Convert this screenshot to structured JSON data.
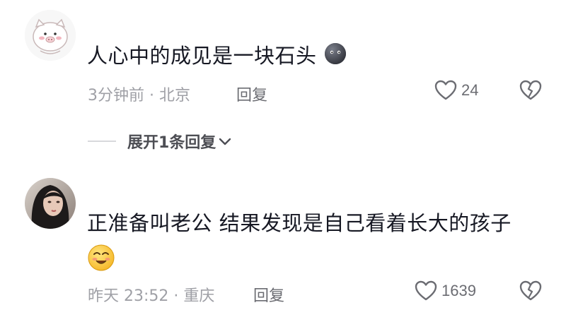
{
  "comments": [
    {
      "username": "",
      "text": "人心中的成见是一块石头",
      "emoji": "dark-blob-emoji",
      "time_location": "3分钟前 · 北京",
      "reply_label": "回复",
      "likes": "24",
      "expand_label": "展开1条回复"
    },
    {
      "username": "",
      "text_line1": "正准备叫老公 结果发现是自己看着长大的孩子",
      "emoji": "smiling-face-emoji",
      "time_location": "昨天 23:52 · 重庆",
      "reply_label": "回复",
      "likes": "1639"
    }
  ],
  "colors": {
    "text": "#161823",
    "meta": "#9fa0a6",
    "action": "#6b6c72"
  }
}
